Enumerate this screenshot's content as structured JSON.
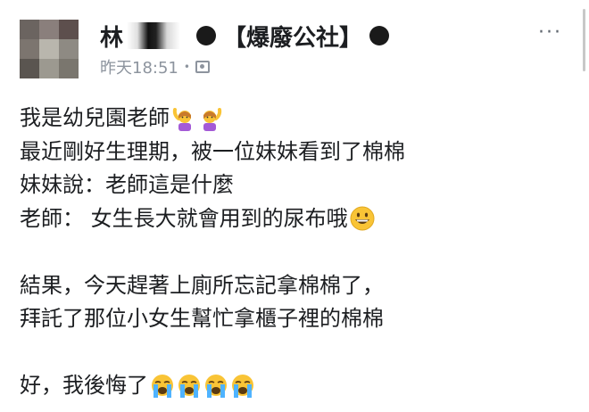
{
  "post": {
    "author_name": "林",
    "group_name": "●【爆廢公社】●",
    "group_open": "【爆廢公社】",
    "timestamp": "昨天18:51",
    "separator": "•",
    "more_label": "···",
    "body_lines": [
      "我是幼兒園老師",
      "最近剛好生理期，被一位妹妹看到了棉棉",
      "妹妹說：老師這是什麼",
      "老師： 女生長大就會用到的尿布哦",
      "結果，今天趕著上廁所忘記拿棉棉了，",
      "拜託了那位小女生幫忙拿櫃子裡的棉棉",
      "好，我後悔了"
    ]
  },
  "icons": {
    "privacy": "group-privacy-icon",
    "raise_hand": "woman-raising-hand-emoji",
    "grin": "grinning-face-emoji",
    "cry": "loudly-crying-face-emoji"
  },
  "colors": {
    "text": "#1c1e21",
    "meta": "#8d949e",
    "emoji_yellow": "#f9c436"
  }
}
